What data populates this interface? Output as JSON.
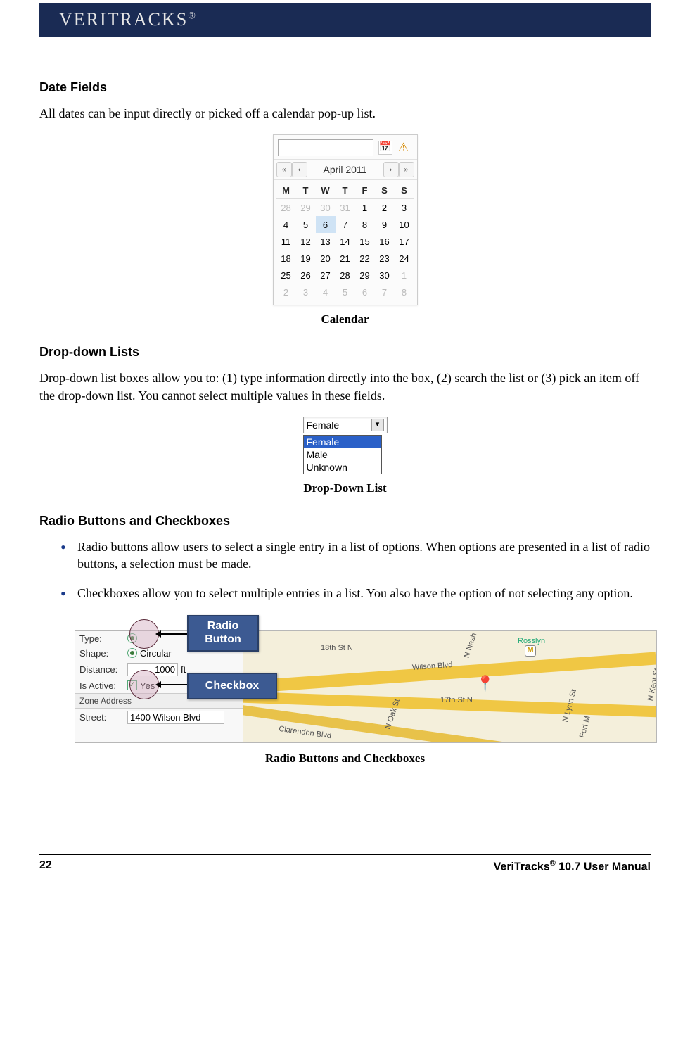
{
  "header": {
    "brand": "VERITRACKS",
    "reg": "®"
  },
  "section_date": {
    "title": "Date Fields",
    "body": "All dates can be input directly or picked off a calendar pop-up list.",
    "caption": "Calendar"
  },
  "calendar": {
    "month_label": "April 2011",
    "nav": {
      "first": "«",
      "prev": "‹",
      "next": "›",
      "last": "»"
    },
    "dow": [
      "M",
      "T",
      "W",
      "T",
      "F",
      "S",
      "S"
    ],
    "weeks": [
      [
        {
          "d": "28",
          "o": true
        },
        {
          "d": "29",
          "o": true
        },
        {
          "d": "30",
          "o": true
        },
        {
          "d": "31",
          "o": true
        },
        {
          "d": "1"
        },
        {
          "d": "2"
        },
        {
          "d": "3"
        }
      ],
      [
        {
          "d": "4"
        },
        {
          "d": "5"
        },
        {
          "d": "6",
          "sel": true
        },
        {
          "d": "7"
        },
        {
          "d": "8"
        },
        {
          "d": "9"
        },
        {
          "d": "10"
        }
      ],
      [
        {
          "d": "11"
        },
        {
          "d": "12"
        },
        {
          "d": "13"
        },
        {
          "d": "14"
        },
        {
          "d": "15"
        },
        {
          "d": "16"
        },
        {
          "d": "17"
        }
      ],
      [
        {
          "d": "18"
        },
        {
          "d": "19"
        },
        {
          "d": "20"
        },
        {
          "d": "21"
        },
        {
          "d": "22"
        },
        {
          "d": "23"
        },
        {
          "d": "24"
        }
      ],
      [
        {
          "d": "25"
        },
        {
          "d": "26"
        },
        {
          "d": "27"
        },
        {
          "d": "28"
        },
        {
          "d": "29"
        },
        {
          "d": "30"
        },
        {
          "d": "1",
          "o": true
        }
      ],
      [
        {
          "d": "2",
          "o": true
        },
        {
          "d": "3",
          "o": true
        },
        {
          "d": "4",
          "o": true
        },
        {
          "d": "5",
          "o": true
        },
        {
          "d": "6",
          "o": true
        },
        {
          "d": "7",
          "o": true
        },
        {
          "d": "8",
          "o": true
        }
      ]
    ]
  },
  "section_dd": {
    "title": "Drop-down Lists",
    "body": "Drop-down list boxes allow you to: (1) type information directly into the box, (2) search the list or (3) pick an item off the drop-down list. You cannot select multiple values in these fields.",
    "caption": "Drop-Down List"
  },
  "dropdown": {
    "selected": "Female",
    "items": [
      "Female",
      "Male",
      "Unknown"
    ]
  },
  "section_rc": {
    "title": "Radio Buttons and Checkboxes",
    "bullets": [
      {
        "pre": "Radio buttons allow users to select a single entry in a list of options. When options are presented in a list of radio buttons, a selection ",
        "u": "must",
        "post": " be made."
      },
      {
        "pre": "Checkboxes allow you to select multiple entries in a list. You also have the option of not selecting any option.",
        "u": "",
        "post": ""
      }
    ],
    "caption": "Radio Buttons and Checkboxes"
  },
  "form": {
    "labels": {
      "type": "Type:",
      "shape": "Shape:",
      "distance": "Distance:",
      "active": "Is Active:",
      "zone": "Zone Address",
      "street": "Street:"
    },
    "shape_val": "Circular",
    "distance_val": "1000",
    "distance_unit": "ft",
    "active_val": "Yes",
    "street_val": "1400 Wilson Blvd"
  },
  "callouts": {
    "radio": "Radio Button",
    "checkbox": "Checkbox"
  },
  "map": {
    "streets": [
      "18th St N",
      "Wilson Blvd",
      "Clarendon Blvd",
      "17th St N",
      "N Nash St",
      "N Oak St",
      "N Lynn St",
      "Fort M",
      "N Kent St",
      "Rosslyn"
    ],
    "metro": "M"
  },
  "footer": {
    "page": "22",
    "title_pre": "VeriTracks",
    "reg": "®",
    "title_post": " 10.7 User Manual"
  }
}
